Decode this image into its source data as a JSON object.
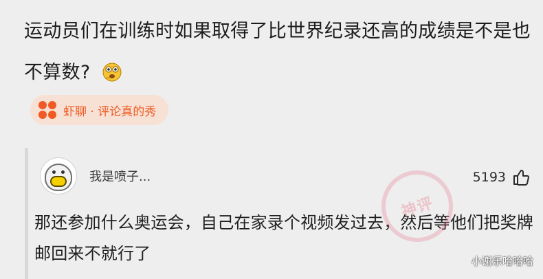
{
  "question": {
    "text": "运动员们在训练时如果取得了比世界纪录还高的成绩是不是也不算数?",
    "emoji": "thinking-face-emoji"
  },
  "tag": {
    "label": "虾聊 · 评论真的秀",
    "icon": "xialiao-logo-icon",
    "color": "#f05a24"
  },
  "comment": {
    "username": "我是喷子...",
    "likes": "5193",
    "like_icon": "thumb-up-icon",
    "text": "那还参加什么奥运会，自己在家录个视频发过去，然后等他们把奖牌邮回来不就行了"
  },
  "stamp": {
    "text": "神评"
  },
  "watermark": {
    "text": "小谢乐哈哈哈"
  },
  "colors": {
    "background": "#eeeeee",
    "accent": "#f05a24",
    "tag_background": "#f6e1d4"
  }
}
